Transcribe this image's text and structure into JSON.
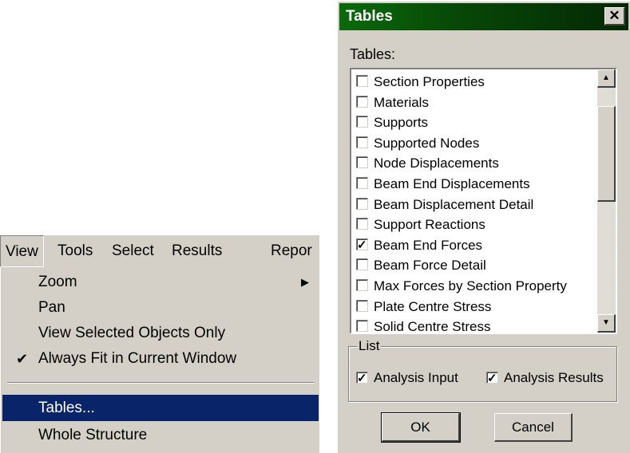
{
  "menubar": {
    "items": [
      "View",
      "Tools",
      "Select",
      "Results",
      "Repor"
    ]
  },
  "view_menu": {
    "items": [
      {
        "label": "Zoom",
        "submenu": true
      },
      {
        "label": "Pan"
      },
      {
        "label": "View Selected Objects Only"
      },
      {
        "label": "Always Fit in Current Window",
        "checked": true
      },
      {
        "label": "Tables...",
        "selected": true
      },
      {
        "label": "Whole Structure"
      }
    ],
    "check_glyph": "✔",
    "submenu_glyph": "▶"
  },
  "dialog": {
    "title": "Tables",
    "close_glyph": "✕",
    "tables_label": "Tables:",
    "tables": [
      {
        "label": "Section Properties",
        "checked": false
      },
      {
        "label": "Materials",
        "checked": false
      },
      {
        "label": "Supports",
        "checked": false
      },
      {
        "label": "Supported Nodes",
        "checked": false
      },
      {
        "label": "Node Displacements",
        "checked": false
      },
      {
        "label": "Beam End Displacements",
        "checked": false
      },
      {
        "label": "Beam Displacement Detail",
        "checked": false
      },
      {
        "label": "Support Reactions",
        "checked": false
      },
      {
        "label": "Beam End Forces",
        "checked": true
      },
      {
        "label": "Beam Force Detail",
        "checked": false
      },
      {
        "label": "Max Forces by Section Property",
        "checked": false
      },
      {
        "label": "Plate Centre Stress",
        "checked": false
      },
      {
        "label": "Solid Centre Stress",
        "checked": false
      }
    ],
    "scroll_up_glyph": "▲",
    "scroll_down_glyph": "▼",
    "list_group": {
      "label": "List",
      "analysis_input": {
        "label": "Analysis Input",
        "checked": true
      },
      "analysis_results": {
        "label": "Analysis Results",
        "checked": true
      }
    },
    "ok_label": "OK",
    "cancel_label": "Cancel",
    "checkmark_glyph": "✓"
  }
}
